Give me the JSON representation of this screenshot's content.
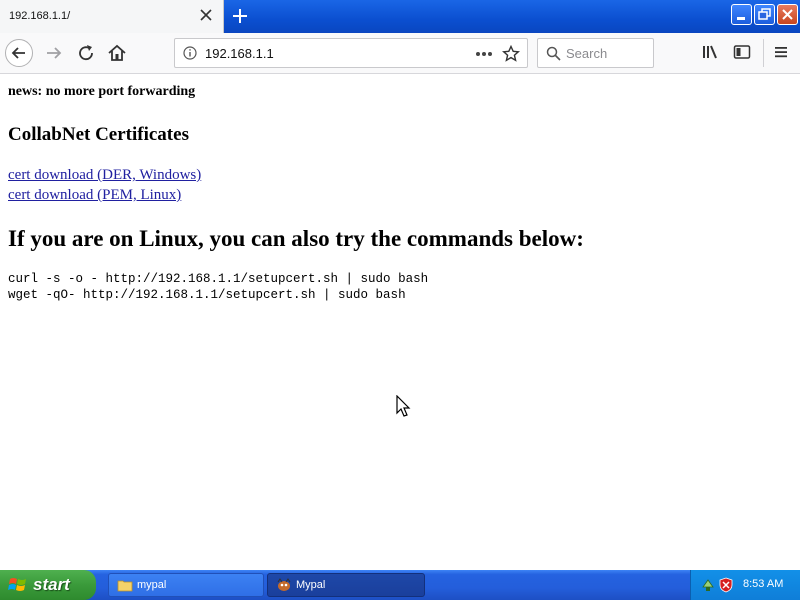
{
  "browser": {
    "tab": {
      "title": "192.168.1.1/"
    },
    "url": "192.168.1.1",
    "search": {
      "placeholder": "Search"
    }
  },
  "page": {
    "news": "news: no more port forwarding",
    "certs_heading": "CollabNet Certificates",
    "links": [
      {
        "label": "cert download (DER, Windows)"
      },
      {
        "label": "cert download (PEM, Linux)"
      }
    ],
    "linux_heading": "If you are on Linux, you can also try the commands below:",
    "commands": [
      "curl -s -o - http://192.168.1.1/setupcert.sh | sudo bash",
      "wget -qO- http://192.168.1.1/setupcert.sh | sudo bash"
    ]
  },
  "taskbar": {
    "start_label": "start",
    "tasks": [
      {
        "label": "mypal",
        "icon": "folder-icon"
      },
      {
        "label": "Mypal",
        "icon": "mypal-browser-icon"
      }
    ],
    "clock": "8:53 AM"
  },
  "colors": {
    "link": "#2020a0",
    "titlebar": "#0b4fd0",
    "taskbar": "#245edb",
    "start": "#3a9a3a"
  }
}
